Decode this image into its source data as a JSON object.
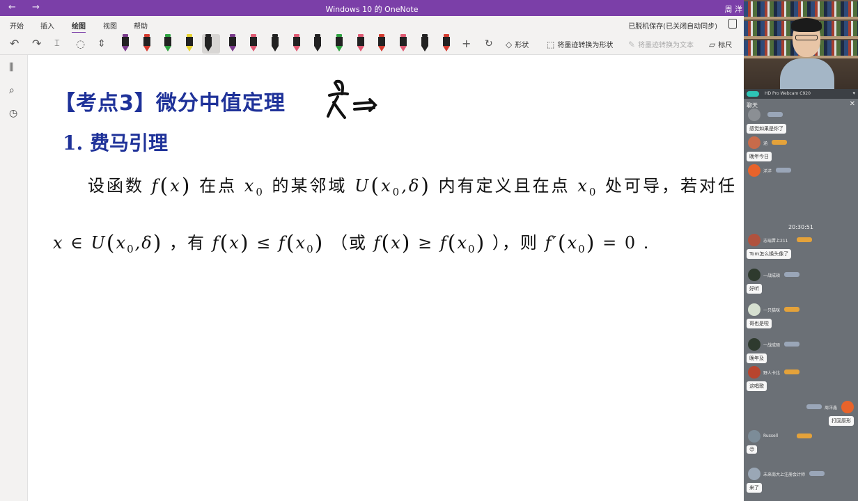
{
  "window": {
    "title": "Windows 10 的 OneNote",
    "user": "周 洋",
    "back_glyph": "←",
    "forward_glyph": "→"
  },
  "ribbon": {
    "tabs": [
      "开始",
      "插入",
      "绘图",
      "视图",
      "帮助"
    ],
    "active_tab": "绘图",
    "sync_status": "已脱机保存(已关闭自动同步)",
    "tools": {
      "undo": "↶",
      "redo": "↷",
      "add": "+",
      "shapes_label": "形状",
      "ink_to_shape_label": "将墨迹转换为形状",
      "ink_to_text_label": "将墨迹转换为文本",
      "ruler_label": "标尺"
    },
    "pen_colors": [
      "#7a3b8c",
      "#d43b2f",
      "#2fa341",
      "#e8d431",
      "#222222",
      "#7a3b8c",
      "#e05a73",
      "#222222",
      "#e05a73",
      "#222222",
      "#2fa341",
      "#e05a73",
      "#d43b2f",
      "#e05a73",
      "#222222",
      "#d43b2f"
    ]
  },
  "note": {
    "heading": "【考点3】微分中值定理",
    "subheading": "1. 费马引理",
    "line1_a": "设函数",
    "line1_b": "在点",
    "line1_c": "的某邻域",
    "line1_d": "内有定义且在点",
    "line1_e": "处可导，若对任",
    "line2_a": "，有",
    "line2_b": "（或",
    "line2_c": "），则",
    "line2_d": "= 0 ."
  },
  "chat": {
    "camera_label": "HD Pro Webcam C920",
    "title": "聊天",
    "timestamp": "20:30:51",
    "messages": [
      {
        "user": "",
        "text": "感觉如果是你了",
        "avatar": "#8b8f94"
      },
      {
        "user": "涵",
        "text": "晚年今日",
        "avatar": "#c86b4a"
      },
      {
        "user": "洋洋",
        "text": "",
        "avatar": "#e8632a"
      },
      {
        "user": "志瑞晋上211",
        "text": "Tom怎么换头像了",
        "avatar": "#b0523e"
      },
      {
        "user": "一战成硕",
        "text": "好听",
        "avatar": "#2e3a2e"
      },
      {
        "user": "一只猫咪",
        "text": "哥也是啦",
        "avatar": "#d6e0d0"
      },
      {
        "user": "一战成硕",
        "text": "晚年及",
        "avatar": "#2e3a2e"
      },
      {
        "user": "野人卡比",
        "text": "这唱歌",
        "avatar": "#b8452e"
      },
      {
        "user": "周洋鑫",
        "text": "打回原形",
        "avatar": "#e8632a",
        "right": true
      },
      {
        "user": "Russell",
        "text": "😊",
        "avatar": "#7c8c98"
      },
      {
        "user": "未来南大上注册会计师",
        "text": "来了",
        "avatar": "#9aa7b6"
      }
    ]
  }
}
